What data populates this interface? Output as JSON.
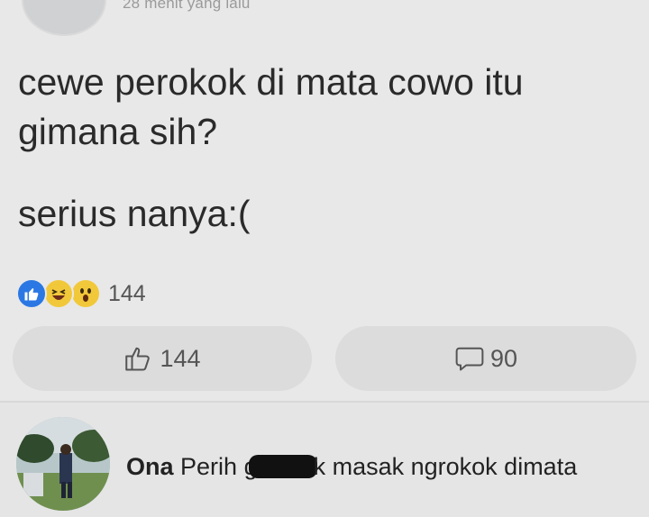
{
  "post": {
    "timestamp": "28 menit yang lalu",
    "text_line1": "cewe perokok di mata cowo itu gimana sih?",
    "text_line2": "serius nanya:("
  },
  "reactions": {
    "icons": [
      "like-icon",
      "haha-icon",
      "wow-icon"
    ],
    "count": "144"
  },
  "actions": {
    "like_count": "144",
    "comment_count": "90"
  },
  "comment": {
    "author": "Ona",
    "text_before": "Perih g",
    "text_after": "k masak ngrokok dimata"
  },
  "colors": {
    "like_blue": "#2b78e4",
    "emoji_yellow": "#f2c83b",
    "background": "#e8e8e8"
  }
}
